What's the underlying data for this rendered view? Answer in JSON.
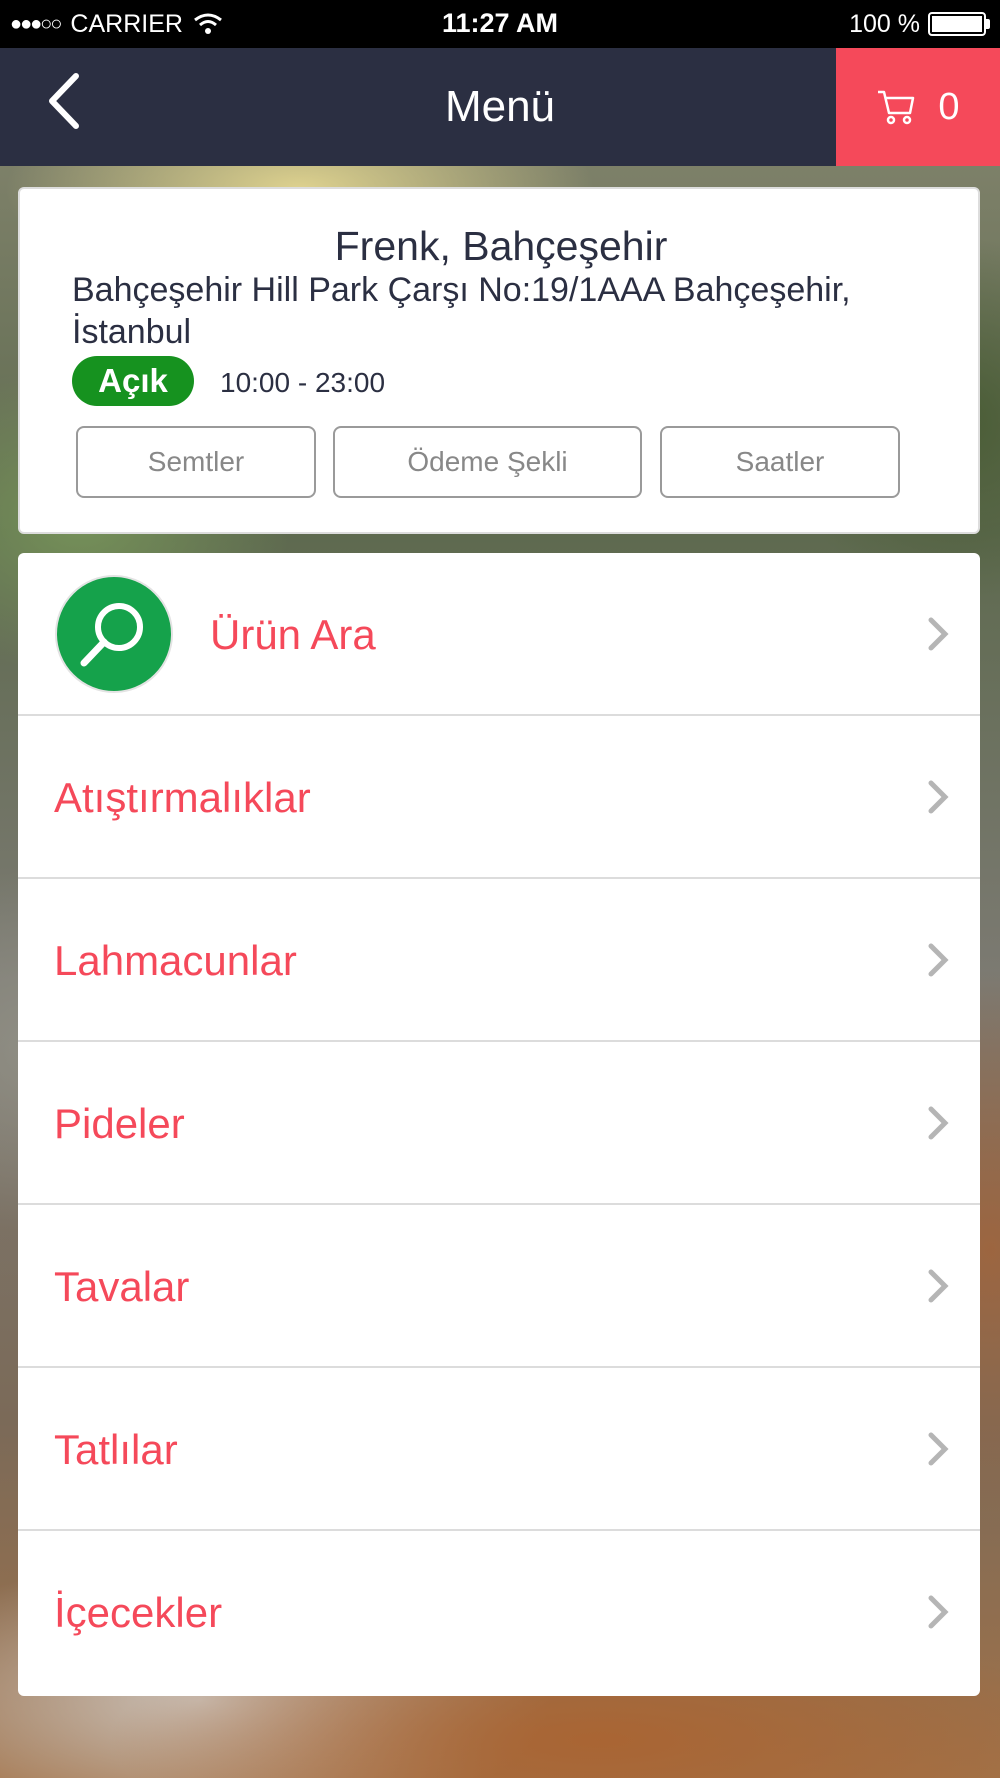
{
  "status_bar": {
    "signal": "●●●○○",
    "carrier": "CARRIER",
    "wifi_icon": "wifi-icon",
    "time": "11:27 AM",
    "battery": "100 %",
    "battery_level_percent": 100
  },
  "nav": {
    "title": "Menü",
    "back_icon": "chevron-left-icon",
    "cart_icon": "cart-icon",
    "cart_count": "0"
  },
  "restaurant": {
    "name": "Frenk, Bahçeşehir",
    "address": "Bahçeşehir Hill Park Çarşı No:19/1AAA Bahçeşehir, İstanbul",
    "status": "Açık",
    "hours": "10:00 - 23:00",
    "buttons": [
      "Semtler",
      "Ödeme Şekli",
      "Saatler"
    ]
  },
  "menu": {
    "search_label": "Ürün Ara",
    "search_icon": "search-icon",
    "categories": [
      "Atıştırmalıklar",
      "Lahmacunlar",
      "Pideler",
      "Tavalar",
      "Tatlılar",
      "İçecekler"
    ]
  },
  "colors": {
    "nav_bg": "#2b2f42",
    "accent_red": "#f5495a",
    "open_green": "#16921f",
    "search_green": "#15a24b"
  }
}
